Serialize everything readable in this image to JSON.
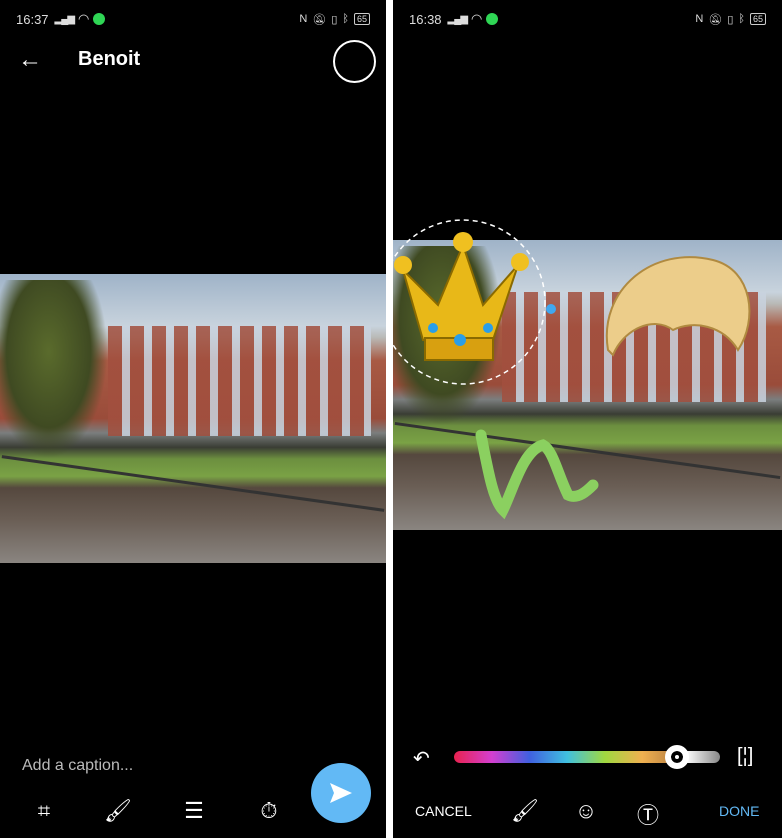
{
  "left": {
    "status": {
      "time": "16:37",
      "battery": "65"
    },
    "header": {
      "title": "Benoit"
    },
    "caption_placeholder": "Add a caption...",
    "tools": [
      "crop-icon",
      "brush-icon",
      "adjust-icon",
      "timer-icon"
    ],
    "send_color": "#62b9f5"
  },
  "right": {
    "status": {
      "time": "16:38",
      "battery": "65"
    },
    "color_slider": {
      "value_percent": 84
    },
    "cancel_label": "CANCEL",
    "done_label": "DONE",
    "done_color": "#62b9f5",
    "tools": [
      "brush-icon",
      "sticker-icon",
      "text-icon"
    ]
  }
}
